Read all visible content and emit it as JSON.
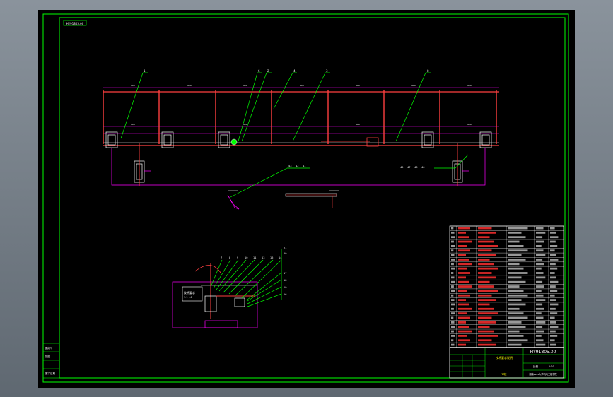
{
  "drawing": {
    "title_stamp": "技术要求说明",
    "drawing_number": "HY91805.00",
    "balloons_top": [
      "1",
      "6",
      "2",
      "4",
      "3",
      "8"
    ],
    "balloons_mid_left": [
      "43",
      "42",
      "41"
    ],
    "balloons_mid_right": [
      "45",
      "47",
      "48",
      "46"
    ],
    "balloons_detail_top": [
      "7",
      "8",
      "9",
      "10",
      "11",
      "13",
      "15",
      "14"
    ],
    "balloons_detail_right": [
      "21",
      "20",
      "17",
      "18",
      "19",
      "16"
    ],
    "note_box": [
      "技术要求",
      "1.1  1.2"
    ],
    "left_stamp": [
      "图纸号",
      "描图",
      "",
      "签字日期"
    ],
    "title_block": {
      "sheet": "1:20",
      "scale_label": "比例",
      "company": "湖南xxxx大学机电工程学院",
      "approve": "审核"
    },
    "colors": {
      "frame": "#00ff00",
      "beam": "#ff4040",
      "dim": "#ff00ff",
      "leader": "#00ff00",
      "text": "#ffffff",
      "yellow": "#ffff00",
      "cyan": "#00ffff"
    }
  }
}
